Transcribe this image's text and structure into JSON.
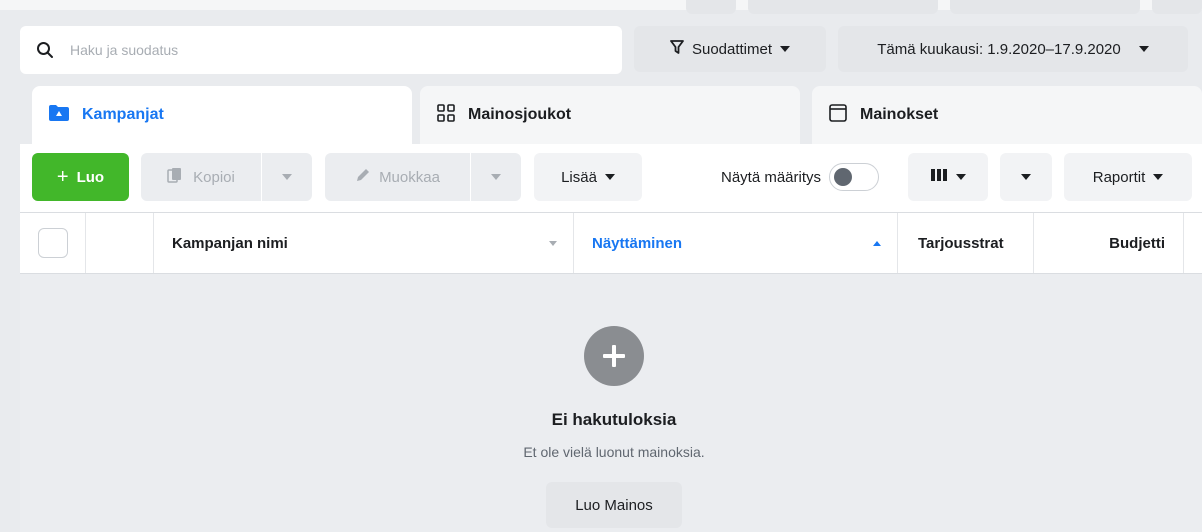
{
  "search": {
    "placeholder": "Haku ja suodatus"
  },
  "filters": {
    "label": "Suodattimet"
  },
  "date_range": {
    "label": "Tämä kuukausi: 1.9.2020–17.9.2020"
  },
  "tabs": [
    {
      "label": "Kampanjat"
    },
    {
      "label": "Mainosjoukot"
    },
    {
      "label": "Mainokset"
    }
  ],
  "toolbar": {
    "create_label": "Luo",
    "copy_label": "Kopioi",
    "edit_label": "Muokkaa",
    "more_label": "Lisää",
    "show_setup_label": "Näytä määritys",
    "reports_label": "Raportit"
  },
  "table": {
    "columns": [
      "Kampanjan nimi",
      "Näyttäminen",
      "Tarjousstrat",
      "Budjetti"
    ]
  },
  "empty_state": {
    "title": "Ei hakutuloksia",
    "subtitle": "Et ole vielä luonut mainoksia.",
    "button_label": "Luo Mainos"
  },
  "colors": {
    "accent": "#1877f2",
    "create_green": "#42b72a",
    "background": "#e9ebee"
  }
}
